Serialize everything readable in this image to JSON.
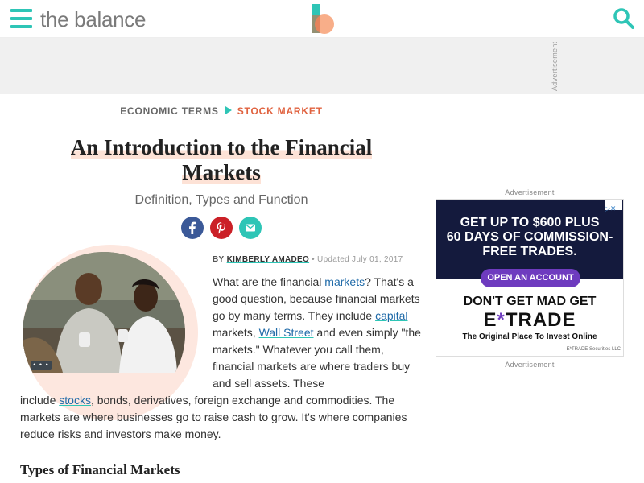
{
  "header": {
    "brand": "the balance",
    "menu_icon": "hamburger-menu-icon",
    "logo_icon": "the-balance-logo",
    "search_icon": "search-icon",
    "accent_color": "#2ec5b6"
  },
  "top_ad": {
    "label": "Advertisement"
  },
  "breadcrumb": {
    "item1": "ECONOMIC TERMS",
    "item2": "STOCK MARKET"
  },
  "article": {
    "title": "An Introduction to the Financial Markets",
    "title_line1": "An Introduction to the Financial",
    "title_line2": "Markets",
    "subtitle": "Definition, Types and Function",
    "social": [
      "facebook-icon",
      "pinterest-icon",
      "email-icon"
    ],
    "image_more": "• • •",
    "byline_by": "BY",
    "author": "KIMBERLY AMADEO",
    "updated": "• Updated July 01, 2017",
    "p1_a": "What are the financial ",
    "p1_link1": "markets",
    "p1_b": "? That's a good question, because financial markets go by many terms. They include ",
    "p1_link2": "capital",
    "p1_c": " markets, ",
    "p1_link3": "Wall Street",
    "p1_d": " and even simply \"the markets.\" Whatever you call them, financial markets are where traders buy and sell assets. These",
    "p2_a": "include ",
    "p2_link1": "stocks",
    "p2_b": ", bonds, derivatives, foreign exchange and commodities. The markets are where businesses go to raise cash to grow. It's where companies reduce risks and investors make money.",
    "section_heading": "Types of Financial Markets"
  },
  "side_ad": {
    "label_top": "Advertisement",
    "label_bottom": "Advertisement",
    "headline_line1": "GET UP TO $600 PLUS",
    "headline_line2": "60 DAYS OF COMMISSION-",
    "headline_line3": "FREE TRADES.",
    "button": "OPEN AN ACCOUNT",
    "dont": "DON'T GET MAD GET",
    "etrade_e": "E",
    "etrade_star": "*",
    "etrade_rest": "TRADE",
    "tagline": "The Original Place To Invest Online",
    "legal": "E*TRADE Securities LLC",
    "adchoice": "▷✕"
  }
}
